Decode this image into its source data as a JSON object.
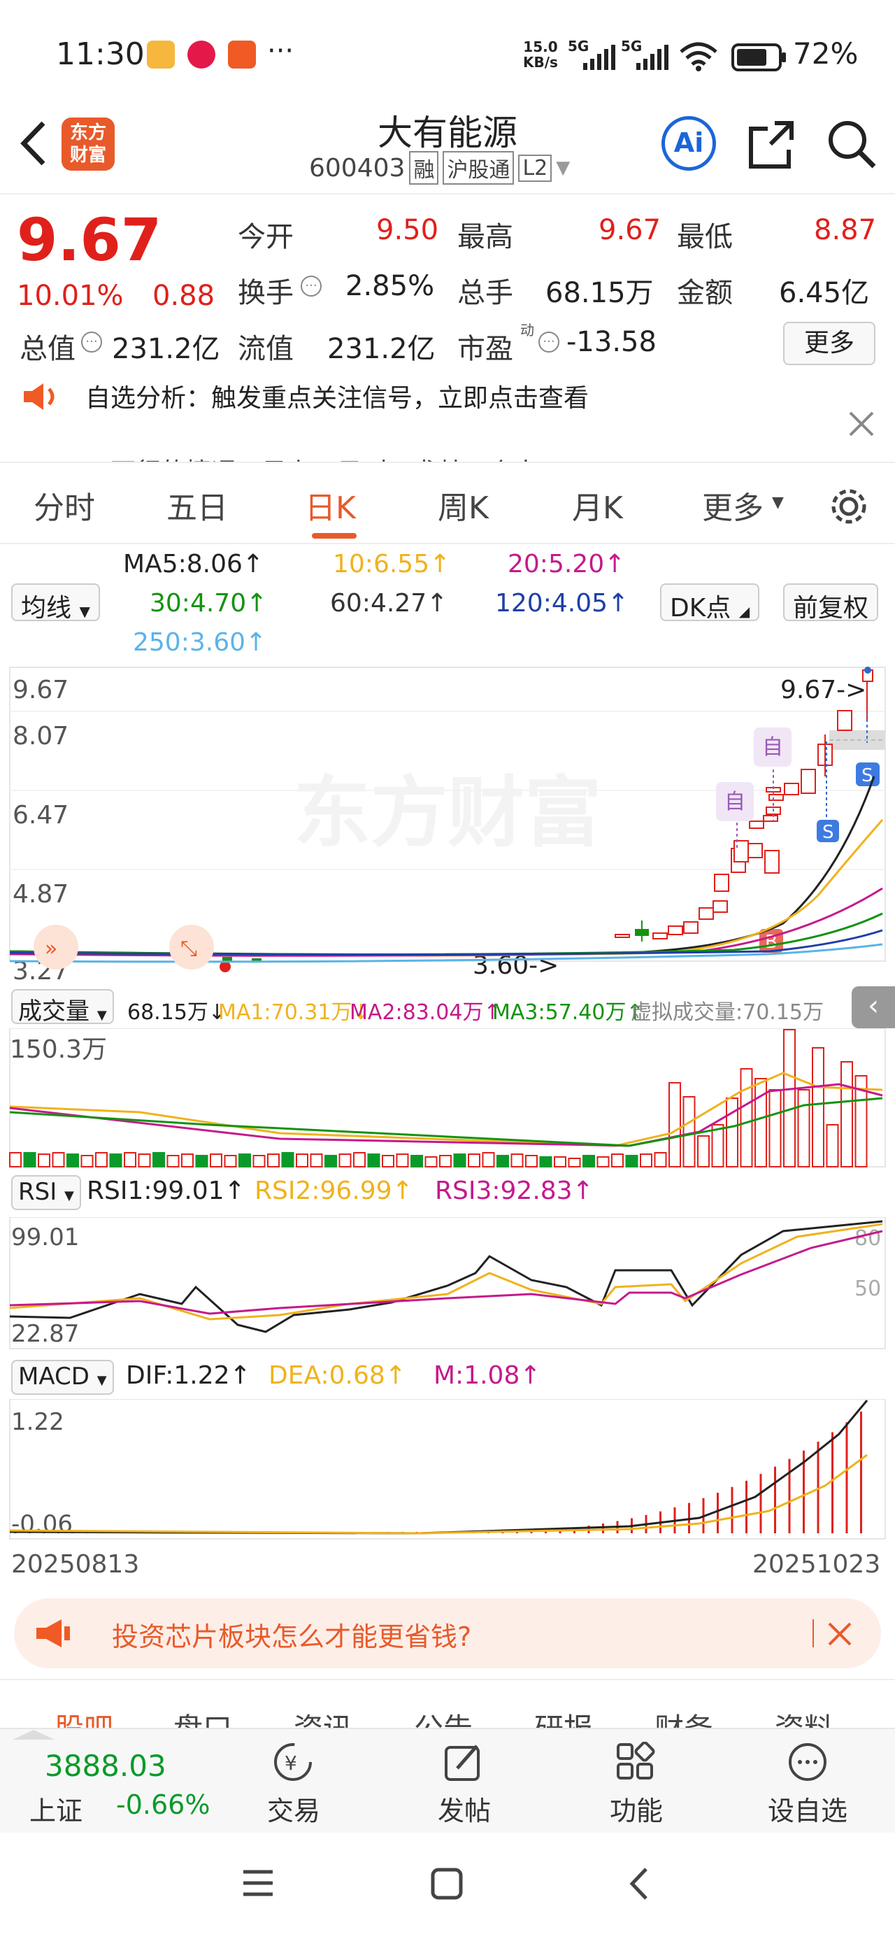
{
  "status": {
    "time": "11:30",
    "net_speed_top": "15.0",
    "net_speed_bottom": "KB/s",
    "sig1": "5G",
    "sig2": "5G",
    "battery": "72%",
    "more": "···"
  },
  "nav": {
    "title": "大有能源",
    "code": "600403",
    "tags": [
      "融",
      "沪股通",
      "L2"
    ],
    "logo_top": "东方",
    "logo_bottom": "财富",
    "ai": "Ai"
  },
  "quote": {
    "price": "9.67",
    "pct": "10.01%",
    "chg": "0.88",
    "r1": [
      [
        "今开",
        "9.50"
      ],
      [
        "最高",
        "9.67"
      ],
      [
        "最低",
        "8.87"
      ]
    ],
    "r2": [
      [
        "换手",
        "2.85%"
      ],
      [
        "总手",
        "68.15万"
      ],
      [
        "金额",
        "6.45亿"
      ]
    ],
    "r3": [
      [
        "总值",
        "231.2亿"
      ],
      [
        "流值",
        "231.2亿"
      ],
      [
        "市盈",
        "-13.58"
      ]
    ],
    "pe_sup": "动",
    "more_btn": "更多"
  },
  "notice": {
    "text": "自选分析：触发重点关注信号，立即点击查看",
    "text2": "一下行的情况，目上一只叫，尤某一个人"
  },
  "tabs": [
    "分时",
    "五日",
    "日K",
    "周K",
    "月K",
    "更多"
  ],
  "ma": {
    "selector": "均线",
    "ma5": "MA5:8.06↑",
    "ma10": "10:6.55↑",
    "ma20": "20:5.20↑",
    "ma30": "30:4.70↑",
    "ma60": "60:4.27↑",
    "ma120": "120:4.05↑",
    "ma250": "250:3.60↑",
    "dk": "DK点",
    "fq": "前复权"
  },
  "kline": {
    "y": [
      "9.67",
      "8.07",
      "6.47",
      "4.87",
      "3.27"
    ],
    "last_label": "9.67->",
    "low_label": "3.60->",
    "zi": "自",
    "s": "S",
    "b": "B",
    "watermark": "东方财富"
  },
  "vol": {
    "selector": "成交量",
    "v": "68.15万↓",
    "ma1": "MA1:70.31万↓",
    "ma2": "MA2:83.04万↑",
    "ma3": "MA3:57.40万↑",
    "virtual": "虚拟成交量:70.15万",
    "y": "150.3万"
  },
  "rsi": {
    "selector": "RSI",
    "r1": "RSI1:99.01↑",
    "r2": "RSI2:96.99↑",
    "r3": "RSI3:92.83↑",
    "top": "99.01",
    "bottom": "22.87",
    "l80": "80",
    "l50": "50"
  },
  "macd": {
    "selector": "MACD",
    "dif": "DIF:1.22↑",
    "dea": "DEA:0.68↑",
    "m": "M:1.08↑",
    "top": "1.22",
    "bottom": "-0.06",
    "d1": "20250813",
    "d2": "20251023"
  },
  "ad": {
    "text": "投资芯片板块怎么才能更省钱?"
  },
  "subtabs": [
    "股吧",
    "盘口",
    "资讯",
    "公告",
    "研报",
    "财务",
    "资料"
  ],
  "bottom": {
    "index": "3888.03",
    "index_name": "上证",
    "index_pct": "-0.66%",
    "items": [
      "交易",
      "发帖",
      "功能",
      "设自选"
    ]
  },
  "colors": {
    "red": "#e0201b",
    "green": "#0a9a2a",
    "ma10": "#f0b21c",
    "ma20": "#c41a8c",
    "ma30": "#13930f",
    "ma120": "#1f3fa8",
    "ma250": "#5ab4e8"
  }
}
